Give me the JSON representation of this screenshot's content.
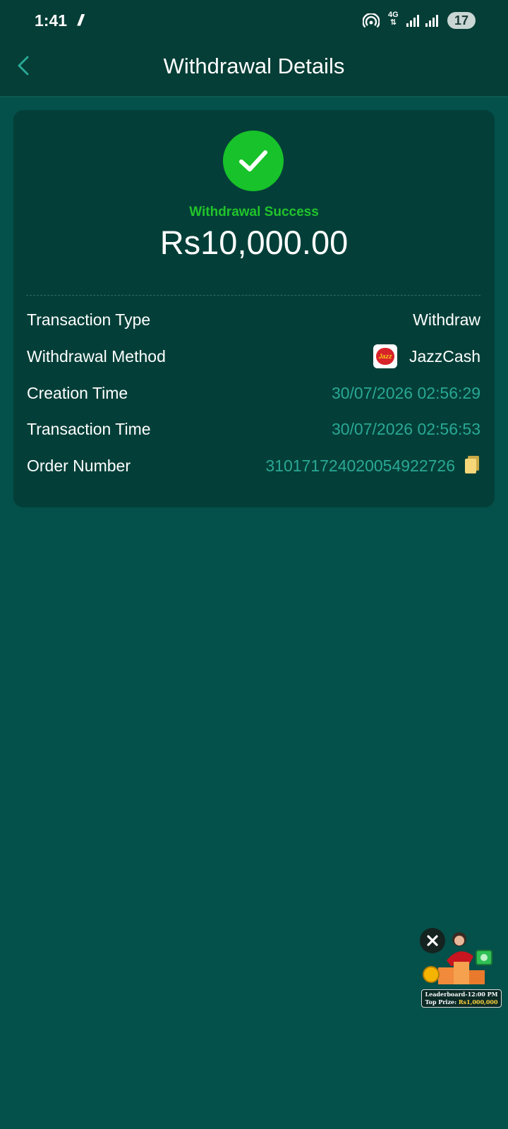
{
  "status_bar": {
    "time": "1:41",
    "network": "4G",
    "battery": "17"
  },
  "header": {
    "title": "Withdrawal Details"
  },
  "summary": {
    "status": "Withdrawal Success",
    "amount": "Rs10,000.00"
  },
  "details": {
    "transaction_type_label": "Transaction Type",
    "transaction_type_value": "Withdraw",
    "method_label": "Withdrawal Method",
    "method_value": "JazzCash",
    "creation_time_label": "Creation Time",
    "creation_time_value": "30/07/2026 02:56:29",
    "transaction_time_label": "Transaction Time",
    "transaction_time_value": "30/07/2026 02:56:53",
    "order_number_label": "Order Number",
    "order_number_value": "310171724020054922726"
  },
  "promo": {
    "line1_prefix": "Leaderboard-",
    "line1_time": "12:00 PM",
    "line2_prefix": "Top Prize: ",
    "line2_amount": "Rs1,000,000"
  },
  "colors": {
    "background": "#04504a",
    "header_bg": "#053e36",
    "card_bg": "#033f38",
    "success_green": "#18c22a",
    "teal_value": "#2aa895",
    "copy_icon": "#f5d77a"
  },
  "icons": {
    "back": "chevron-left-icon",
    "success": "check-circle-icon",
    "method_logo": "jazzcash-logo",
    "copy": "copy-icon",
    "promo_close": "close-icon"
  }
}
